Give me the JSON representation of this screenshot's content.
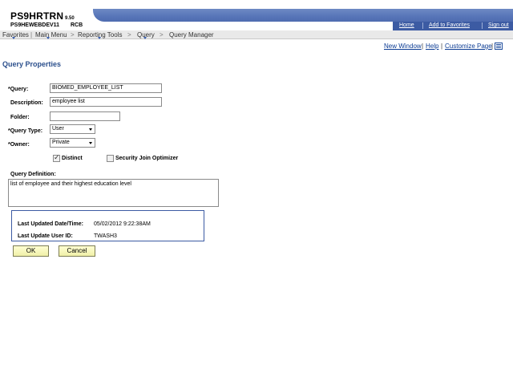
{
  "header": {
    "db_name": "PS9HRTRN",
    "db_version": "9.50",
    "server_name": "PS9HEWEBDEV11",
    "user_name": "RCB",
    "links": [
      "Home",
      "Add to Favorites",
      "Sign out"
    ]
  },
  "navbar": {
    "items": [
      "Favorites",
      "Main Menu",
      "Reporting Tools",
      "Query",
      "Query Manager"
    ],
    "separators": [
      "|",
      ">",
      ">",
      ">"
    ]
  },
  "page_links": {
    "new_window": "New Window",
    "help": "Help",
    "customize": "Customize Page",
    "sep": "|"
  },
  "page_title": "Query Properties",
  "form": {
    "query_label": "*Query:",
    "query_value": "BIOMED_EMPLOYEE_LIST",
    "description_label": "Description:",
    "description_value": "employee list",
    "folder_label": "Folder:",
    "folder_value": "",
    "query_type_label": "*Query Type:",
    "query_type_value": "User",
    "owner_label": "*Owner:",
    "owner_value": "Private",
    "distinct_label": "Distinct",
    "distinct_checked": true,
    "security_join_label": "Security Join Optimizer",
    "security_join_checked": false,
    "definition_label": "Query Definition:",
    "definition_value": "list of employee and their highest education level"
  },
  "info": {
    "last_updated_label": "Last Updated Date/Time:",
    "last_updated_value": "05/02/2012  9:22:38AM",
    "last_user_label": "Last Update User ID:",
    "last_user_value": "TWASH3"
  },
  "buttons": {
    "ok": "OK",
    "cancel": "Cancel"
  },
  "colors": {
    "banner": "#5775b8",
    "title": "#2b4f8c",
    "link": "#0b3b93",
    "button_bg": "#f6f6b8"
  }
}
